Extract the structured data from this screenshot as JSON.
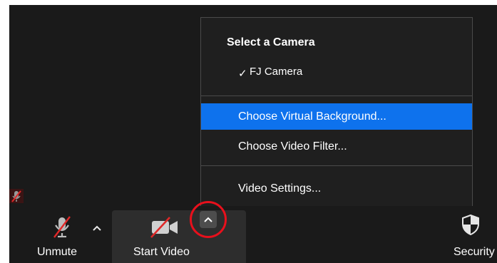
{
  "toolbar": {
    "unmute_label": "Unmute",
    "start_video_label": "Start Video",
    "security_label": "Security"
  },
  "camera_menu": {
    "header": "Select a Camera",
    "checkmark": "✓",
    "selected_camera": "FJ Camera",
    "items": [
      {
        "label": "Choose Virtual Background..."
      },
      {
        "label": "Choose Video Filter..."
      },
      {
        "label": "Video Settings..."
      }
    ]
  },
  "colors": {
    "highlight": "#0e72ed",
    "annotation_ring": "#e8101c",
    "mute_slash": "#e02828"
  },
  "icons": {
    "mic": "mic-muted-icon",
    "video": "video-off-icon",
    "security": "shield-icon",
    "caret": "chevron-up-icon"
  }
}
